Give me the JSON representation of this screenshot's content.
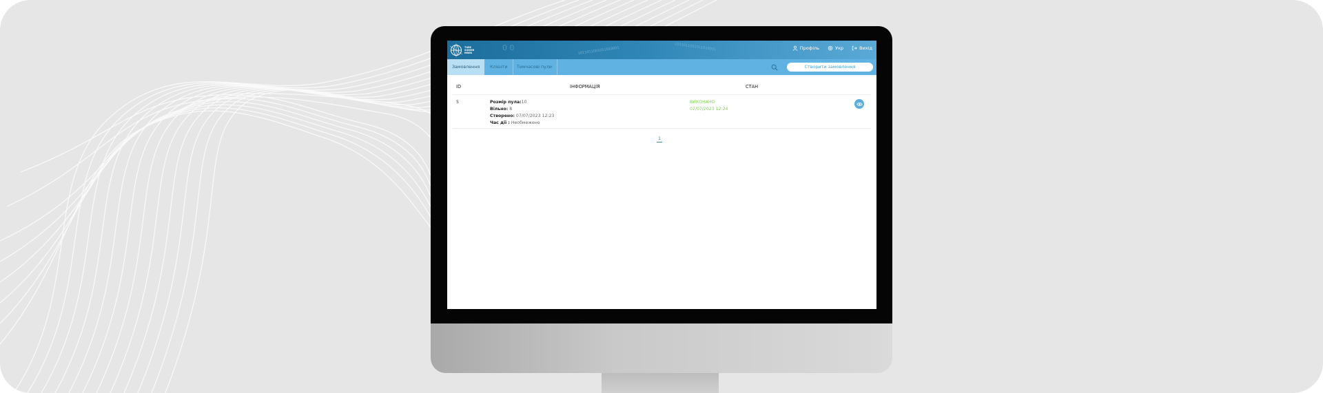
{
  "header": {
    "logo_lines": [
      "TURE",
      "SIGHER",
      "MNEK"
    ],
    "binary_text": "1011011001011010001",
    "profile_label": "Профіль",
    "lang_label": "Укр",
    "logout_label": "Вихід"
  },
  "subnav": {
    "tabs": [
      {
        "label": "Замовлення"
      },
      {
        "label": "Клієнти"
      },
      {
        "label": "Тимчасові пули"
      }
    ],
    "create_order_label": "Створити замовлення"
  },
  "table": {
    "headers": {
      "id": "ID",
      "info": "ІНФОРМАЦІЯ",
      "status": "СТАН"
    },
    "rows": [
      {
        "id": "5",
        "pool_size_label": "Розмір пула:",
        "pool_size_value": "10",
        "free_label": "Вільно:",
        "free_value": "8",
        "created_label": "Створено:",
        "created_value": "07/07/2023 12:23",
        "action_time_label": "Час дії :",
        "action_time_value": "Необмежено",
        "status_text": "ВИКОНАНО",
        "status_date": "07/07/2023 12:24"
      }
    ]
  },
  "pagination": {
    "current": "1"
  },
  "colors": {
    "header_blue": "#2f86b6",
    "subnav_blue": "#5fb2e2",
    "status_green": "#7bd44a",
    "page_background": "#e6e6e6"
  }
}
